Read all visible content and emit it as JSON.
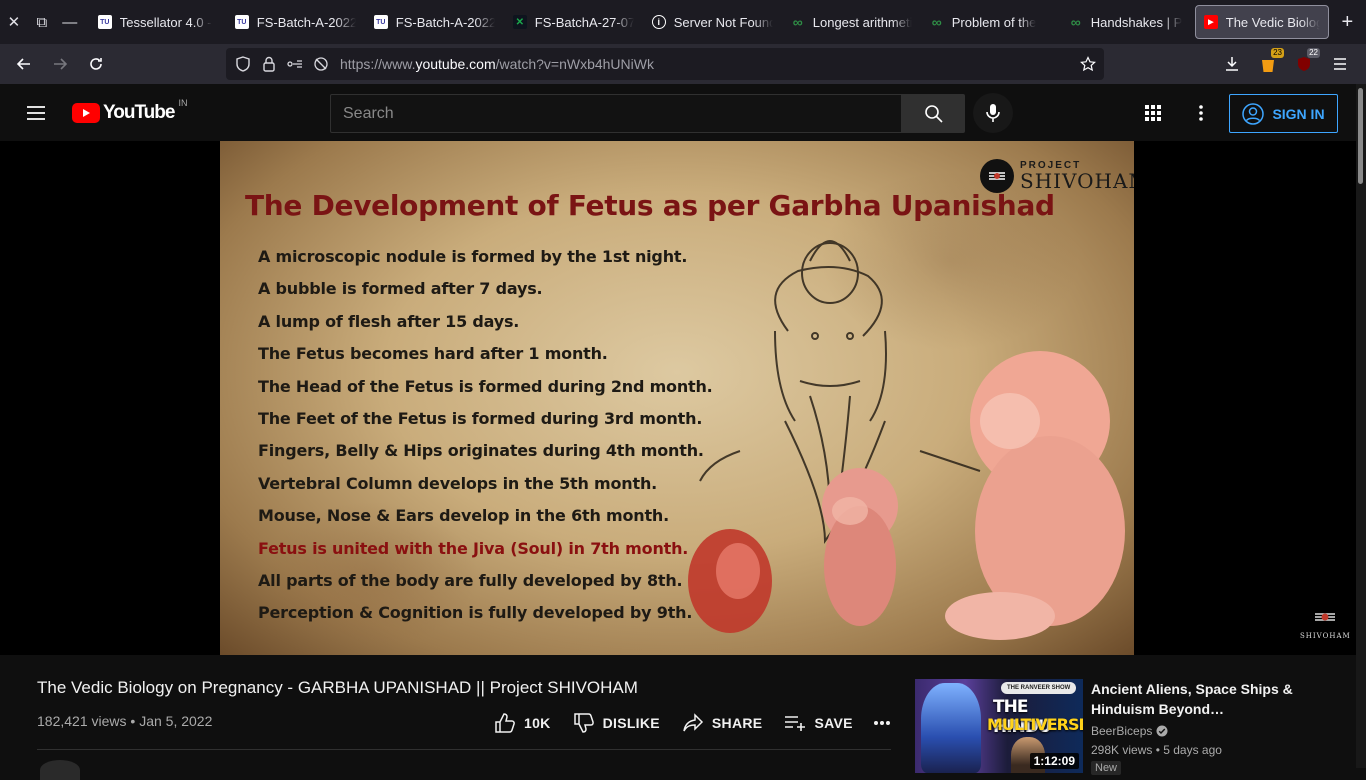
{
  "browser": {
    "tabs": [
      {
        "title": "Tessellator 4.0 -",
        "favicon": "tessellator-favicon",
        "color": "#ffffff"
      },
      {
        "title": "FS-Batch-A-2022",
        "favicon": "tessellator-favicon",
        "color": "#ffffff"
      },
      {
        "title": "FS-Batch-A-2022",
        "favicon": "tessellator-favicon",
        "color": "#ffffff"
      },
      {
        "title": "FS-BatchA-27-07",
        "favicon": "hackerrank-favicon",
        "color": "#1ba94c"
      },
      {
        "title": "Server Not Found",
        "favicon": "info-icon",
        "color": "#ffffff"
      },
      {
        "title": "Longest arithmetic",
        "favicon": "gfg-favicon",
        "color": "#2f8d46"
      },
      {
        "title": "Problem of the",
        "favicon": "gfg-favicon",
        "color": "#2f8d46"
      },
      {
        "title": "Handshakes | P",
        "favicon": "gfg-favicon",
        "color": "#2f8d46"
      },
      {
        "title": "The Vedic Biology",
        "favicon": "youtube-favicon",
        "color": "#ff0000",
        "active": true
      }
    ],
    "url_host": "https://www.",
    "url_domain": "youtube.com",
    "url_path": "/watch?v=nWxb4hUNiWk",
    "extension_badge_1": "23",
    "extension_badge_2": "22"
  },
  "youtube": {
    "logo_text": "YouTube",
    "country_code": "IN",
    "search_placeholder": "Search",
    "sign_in_label": "SIGN IN"
  },
  "frame": {
    "title": "The Development of Fetus as per Garbha Upanishad",
    "brand_small": "PROJECT",
    "brand_big": "SHIVOHAM",
    "lines": [
      {
        "text": "A microscopic nodule is formed by the 1st night.",
        "red": false
      },
      {
        "text": "A bubble is formed after 7 days.",
        "red": false
      },
      {
        "text": "A lump of flesh after 15 days.",
        "red": false
      },
      {
        "text": "The Fetus becomes hard after 1 month.",
        "red": false
      },
      {
        "text": "The Head of the Fetus is formed during 2nd month.",
        "red": false
      },
      {
        "text": "The Feet of the Fetus is formed during 3rd  month.",
        "red": false
      },
      {
        "text": "Fingers, Belly & Hips originates during 4th month.",
        "red": false
      },
      {
        "text": "Vertebral Column develops in the 5th month.",
        "red": false
      },
      {
        "text": "Mouse, Nose & Ears develop in the 6th month.",
        "red": false
      },
      {
        "text": "Fetus is united with the Jiva (Soul) in 7th month.",
        "red": true
      },
      {
        "text": "All parts of the body are fully developed by 8th.",
        "red": false
      },
      {
        "text": "Perception & Cognition is fully developed by 9th.",
        "red": false
      }
    ],
    "watermark": "SHIVOHAM"
  },
  "video": {
    "title": "The Vedic Biology on Pregnancy - GARBHA UPANISHAD || Project SHIVOHAM",
    "views": "182,421 views",
    "separator": "•",
    "date": "Jan 5, 2022",
    "like_count": "10K",
    "dislike_label": "DISLIKE",
    "share_label": "SHARE",
    "save_label": "SAVE"
  },
  "recommendation": {
    "title": "Ancient Aliens, Space Ships & Hinduism Beyond…",
    "channel": "BeerBiceps",
    "meta": "298K views • 5 days ago",
    "duration": "1:12:09",
    "badge": "New",
    "thumb_pill": "THE RANVEER SHOW",
    "thumb_line1": "THE HINDU",
    "thumb_line2": "MULTIVERSE"
  }
}
